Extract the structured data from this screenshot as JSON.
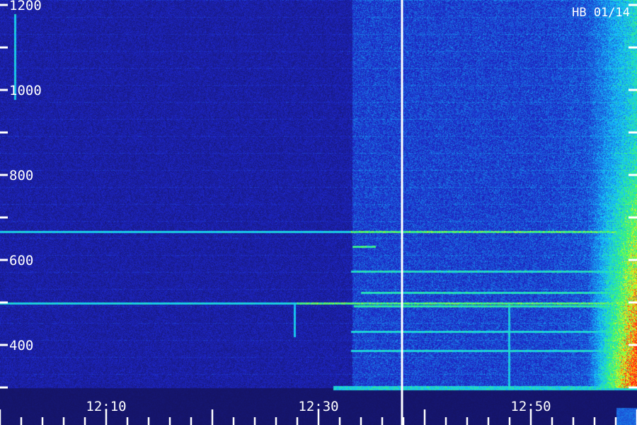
{
  "chart_data": {
    "type": "heatmap",
    "station_label": "HB 01/14",
    "y_axis": {
      "range": [
        300,
        1200
      ],
      "tick_step": 100,
      "labeled_ticks": [
        {
          "value": 400,
          "label": "400"
        },
        {
          "value": 600,
          "label": "600"
        },
        {
          "value": 800,
          "label": "800"
        },
        {
          "value": 1000,
          "label": "1000"
        },
        {
          "value": 1200,
          "label": "1200"
        }
      ]
    },
    "x_axis": {
      "range_minutes": [
        12.0,
        60.0
      ],
      "labeled_ticks": [
        {
          "value": 12.1,
          "label": "12:10"
        },
        {
          "value": 12.3,
          "label": "12:30"
        },
        {
          "value": 12.5,
          "label": "12:50"
        }
      ]
    },
    "marker_time": "12:39",
    "colors": {
      "background": "#14125a",
      "low": "#1a22c8",
      "mid": "#20c8ff",
      "high": "#30ff60",
      "peak": "#ff2a10",
      "axis": "#ffffff"
    }
  }
}
